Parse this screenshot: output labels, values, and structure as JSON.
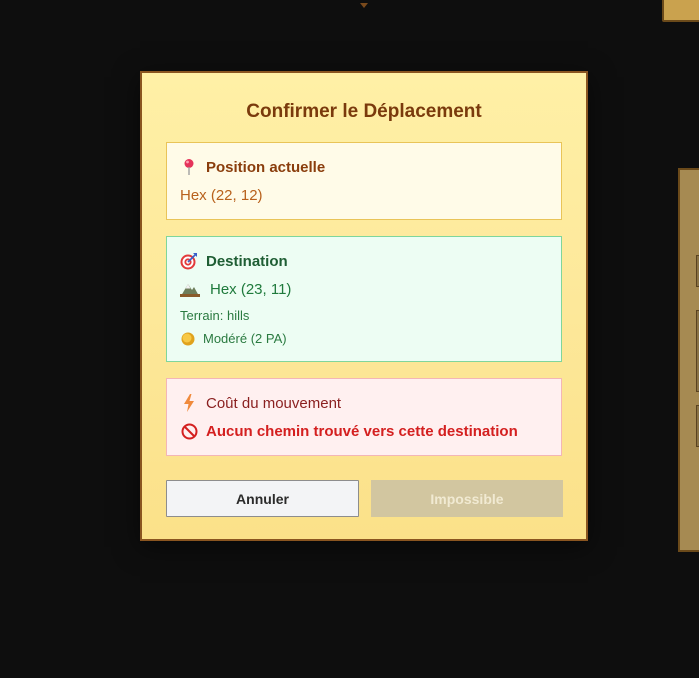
{
  "modal": {
    "title": "Confirmer le Déplacement",
    "current": {
      "icon": "pin-icon",
      "heading": "Position actuelle",
      "value": "Hex (22, 12)"
    },
    "destination": {
      "icon": "target-icon",
      "heading": "Destination",
      "terrain_icon": "mountain-icon",
      "value": "Hex (23, 11)",
      "terrain": "Terrain: hills",
      "difficulty_icon": "coin-icon",
      "difficulty": "Modéré (2 PA)"
    },
    "cost": {
      "icon": "lightning-icon",
      "heading": "Coût du mouvement",
      "error_icon": "prohibited-icon",
      "error": "Aucun chemin trouvé vers cette destination"
    },
    "buttons": {
      "cancel": "Annuler",
      "confirm": "Impossible"
    }
  },
  "colors": {
    "modal_bg": "#fde89a",
    "modal_border": "#8a5520",
    "title": "#7a3a0c",
    "current_bg": "#fffbe8",
    "destination_bg": "#edfdf3",
    "cost_bg": "#fff0f0",
    "error": "#d42020",
    "disabled_button": "#d2c6a0"
  }
}
